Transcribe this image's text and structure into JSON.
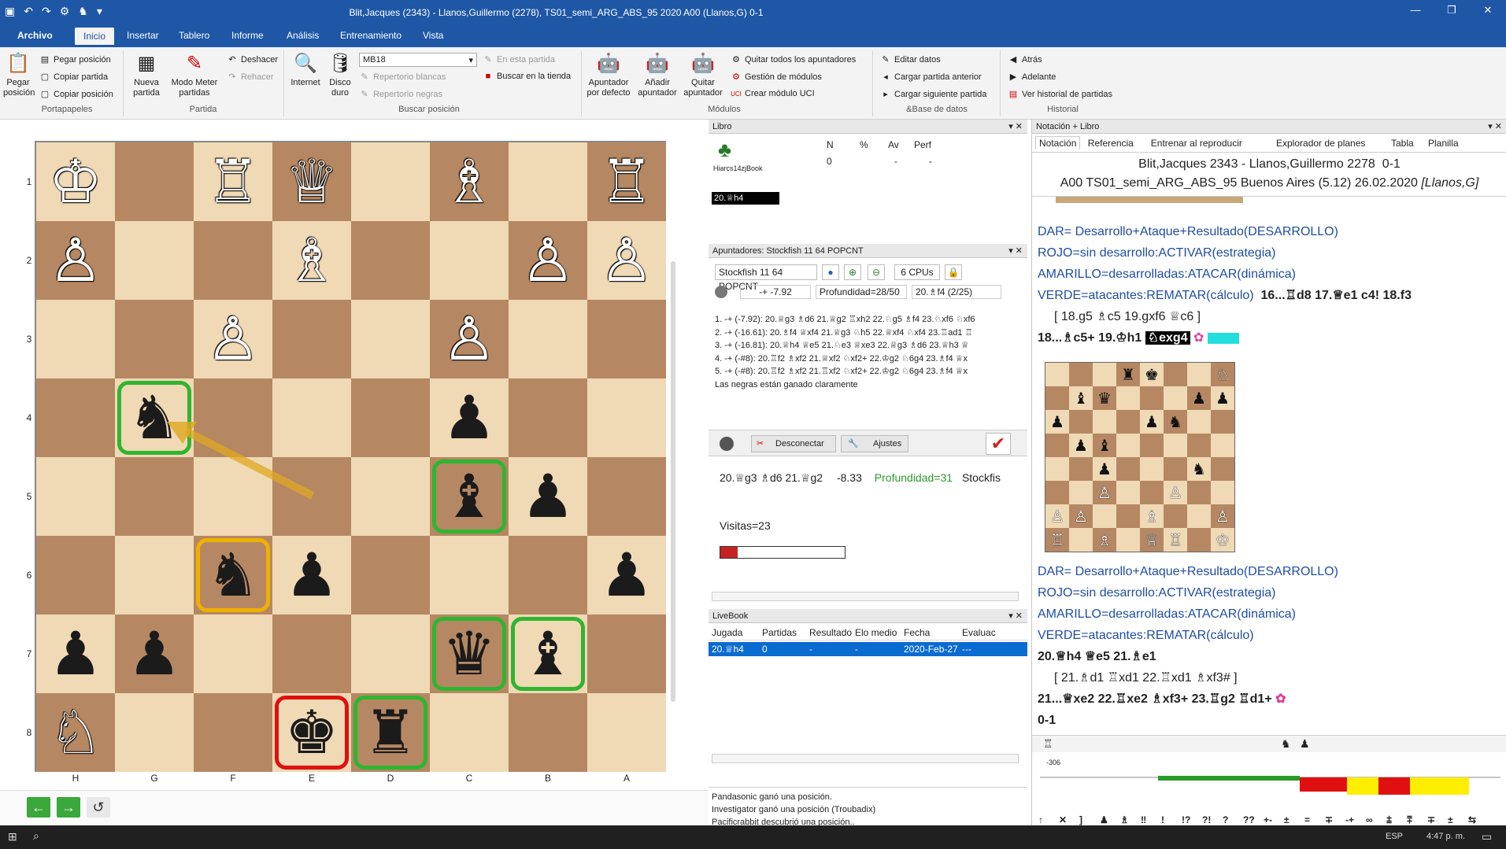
{
  "app": {
    "title": "Blit,Jacques (2343) - Llanos,Guillermo (2278), TS01_semi_ARG_ABS_95  2020  A00  (Llanos,G)  0-1"
  },
  "tabs": [
    {
      "label": "Archivo"
    },
    {
      "label": "Inicio"
    },
    {
      "label": "Insertar"
    },
    {
      "label": "Tablero"
    },
    {
      "label": "Informe"
    },
    {
      "label": "Análisis"
    },
    {
      "label": "Entrenamiento"
    },
    {
      "label": "Vista"
    }
  ],
  "ribbon": {
    "pegar_posicion_big": "Pegar posición",
    "pegar_posicion": "Pegar posición",
    "copiar_partida": "Copiar partida",
    "copiar_posicion": "Copiar posición",
    "portapapeles": "Portapapeles",
    "nueva_partida": "Nueva partida",
    "modo_meter": "Modo Meter partidas",
    "deshacer": "Deshacer",
    "rehacer": "Rehacer",
    "partida": "Partida",
    "internet": "Internet",
    "disco_duro": "Disco duro",
    "db_select": "MB18",
    "en_esta_partida": "En esta partida",
    "repertorio_blancas": "Repertorio blancas",
    "repertorio_negras": "Repertorio negras",
    "buscar_tienda": "Buscar en la tienda",
    "buscar_posicion": "Buscar posición",
    "apuntador_defecto": "Apuntador por defecto",
    "anadir_apuntador": "Añadir apuntador",
    "quitar_apuntador": "Quitar apuntador",
    "quitar_todos": "Quitar todos los apuntadores",
    "gestion_modulos": "Gestión de módulos",
    "crear_uci": "Crear módulo UCI",
    "modulos": "Módulos",
    "editar_datos": "Editar datos",
    "cargar_anterior": "Cargar partida anterior",
    "cargar_siguiente": "Cargar siguiente partida",
    "base_datos": "&Base de datos",
    "atras": "Atrás",
    "adelante": "Adelante",
    "ver_historial": "Ver historial de partidas",
    "historial": "Historial"
  },
  "board": {
    "ranks": [
      "1",
      "2",
      "3",
      "4",
      "5",
      "6",
      "7",
      "8"
    ],
    "files": [
      "H",
      "G",
      "F",
      "E",
      "D",
      "C",
      "B",
      "A"
    ],
    "pieces": [
      {
        "sq": "a",
        "r": 0,
        "f": 0,
        "g": "♔",
        "c": "w"
      },
      {
        "r": 0,
        "f": 2,
        "g": "♖",
        "c": "w"
      },
      {
        "r": 0,
        "f": 3,
        "g": "♕",
        "c": "w"
      },
      {
        "r": 0,
        "f": 5,
        "g": "♗",
        "c": "w"
      },
      {
        "r": 0,
        "f": 7,
        "g": "♖",
        "c": "w"
      },
      {
        "r": 1,
        "f": 0,
        "g": "♙",
        "c": "w"
      },
      {
        "r": 1,
        "f": 3,
        "g": "♗",
        "c": "w"
      },
      {
        "r": 1,
        "f": 6,
        "g": "♙",
        "c": "w"
      },
      {
        "r": 1,
        "f": 7,
        "g": "♙",
        "c": "w"
      },
      {
        "r": 2,
        "f": 2,
        "g": "♙",
        "c": "w"
      },
      {
        "r": 2,
        "f": 5,
        "g": "♙",
        "c": "w"
      },
      {
        "r": 3,
        "f": 1,
        "g": "♞",
        "c": "b"
      },
      {
        "r": 3,
        "f": 5,
        "g": "♟",
        "c": "b"
      },
      {
        "r": 4,
        "f": 5,
        "g": "♝",
        "c": "b"
      },
      {
        "r": 4,
        "f": 6,
        "g": "♟",
        "c": "b"
      },
      {
        "r": 5,
        "f": 2,
        "g": "♞",
        "c": "b"
      },
      {
        "r": 5,
        "f": 3,
        "g": "♟",
        "c": "b"
      },
      {
        "r": 5,
        "f": 7,
        "g": "♟",
        "c": "b"
      },
      {
        "r": 6,
        "f": 0,
        "g": "♟",
        "c": "b"
      },
      {
        "r": 6,
        "f": 1,
        "g": "♟",
        "c": "b"
      },
      {
        "r": 6,
        "f": 5,
        "g": "♛",
        "c": "b"
      },
      {
        "r": 6,
        "f": 6,
        "g": "♝",
        "c": "b"
      },
      {
        "r": 7,
        "f": 0,
        "g": "♘",
        "c": "w"
      },
      {
        "r": 7,
        "f": 3,
        "g": "♚",
        "c": "b"
      },
      {
        "r": 7,
        "f": 4,
        "g": "♜",
        "c": "b"
      }
    ],
    "highlights": [
      {
        "r": 3,
        "f": 1,
        "c": "#2fb52f"
      },
      {
        "r": 4,
        "f": 5,
        "c": "#2fb52f"
      },
      {
        "r": 5,
        "f": 2,
        "c": "#f0b000"
      },
      {
        "r": 6,
        "f": 5,
        "c": "#2fb52f"
      },
      {
        "r": 6,
        "f": 6,
        "c": "#2fb52f"
      },
      {
        "r": 7,
        "f": 3,
        "c": "#e01010"
      },
      {
        "r": 7,
        "f": 4,
        "c": "#2fb52f"
      }
    ]
  },
  "libro": {
    "title": "Libro",
    "h_n": "N",
    "h_pct": "%",
    "h_av": "Av",
    "h_perf": "Perf",
    "book": "Hiarcs14zjBook",
    "n": "0",
    "pct": "-",
    "av": "-",
    "perf": "-",
    "move": "20.♕h4"
  },
  "apuntadores": {
    "title": "Apuntadores: Stockfish 11 64 POPCNT",
    "engine": "Stockfish 11 64 POPCNT",
    "cpus": "6 CPUs",
    "eval": "-+ -7.92",
    "depth": "Profundidad=28/50",
    "curmove": "20.♗f4 (2/25)",
    "lines": [
      "1. -+ (-7.92): 20.♕g3 ♗d6 21.♕g2 ♖xh2 22.♘g5 ♗f4 23.♘xf6 ♘xf6",
      "2. -+ (-16.61): 20.♗f4 ♕xf4 21.♕g3 ♘h5 22.♕xf4 ♘xf4 23.♖ad1 ♖",
      "3. -+ (-16.81): 20.♕h4 ♕e5 21.♘e3 ♕xe3 22.♕g3 ♗d6 23.♕h3 ♕",
      "4. -+ (-#8): 20.♖f2 ♗xf2 21.♕xf2 ♘xf2+ 22.♔g2 ♘6g4 23.♗f4 ♕x",
      "5. -+ (-#8): 20.♖f2 ♗xf2 21.♖xf2 ♘xf2+ 22.♔g2 ♘6g4 23.♗f4 ♕x"
    ],
    "verdict": "Las negras están ganado claramente"
  },
  "kibitzer": {
    "desconectar": "Desconectar",
    "ajustes": "Ajustes",
    "line": "20.♕g3 ♗d6 21.♕g2",
    "score": "-8.33",
    "depth": "Profundidad=31",
    "engine": "Stockfis",
    "visitas": "Visitas=23",
    "progress": 0.14
  },
  "livebook": {
    "title": "LiveBook",
    "headers": [
      "Jugada",
      "Partidas",
      "Resultado",
      "Elo medio",
      "Fecha",
      "Evaluac"
    ],
    "row": [
      "20.♕h4",
      "0",
      "-",
      "-",
      "2020-Feb-27",
      "---"
    ]
  },
  "log": [
    "Pandasonic ganó una posición.",
    "Investigator ganó una posición (Troubadix)",
    "Pacificrabbit descubrió una posición.."
  ],
  "notacion": {
    "title": "Notación + Libro",
    "tabs": [
      "Notación",
      "Referencia",
      "Entrenar al reproducir",
      "Explorador de planes",
      "Tabla",
      "Planilla"
    ],
    "players": "Blit,Jacques",
    "elo1": "2343",
    "sep": "-",
    "black": "Llanos,Guillermo",
    "elo2": "2278",
    "result": "0-1",
    "info": "A00 TS01_semi_ARG_ABS_95  Buenos Aires (5.12) 26.02.2020",
    "annot": "[Llanos,G]",
    "l1": "DAR= Desarrollo+Ataque+Resultado(DESARROLLO)",
    "l2": "ROJO=sin desarrollo:ACTIVAR(estrategia)",
    "l3": "AMARILLO=desarrolladas:ATACAR(dinámica)",
    "l4a": "VERDE=atacantes:REMATAR(cálculo)",
    "l4b": "16...♖d8  17.♕e1  c4!  18.f3",
    "l5": "[ 18.g5  ♗c5  19.gxf6  ♕c6 ]",
    "l6": "18...♗c5+  19.♔h1",
    "cur": "♘exg4",
    "m1": "DAR= Desarrollo+Ataque+Resultado(DESARROLLO)",
    "m2": "ROJO=sin desarrollo:ACTIVAR(estrategia)",
    "m3": "AMARILLO=desarrolladas:ATACAR(dinámica)",
    "m4": "VERDE=atacantes:REMATAR(cálculo)",
    "m5": "20.♕h4  ♕e5  21.♗e1",
    "m6": "[ 21.♗d1  ♖xd1  22.♖xd1  ♗xf3# ]",
    "m7": "21...♕xe2  22.♖xe2  ♗xf3+  23.♖g2  ♖d1+",
    "m8": "0-1",
    "graph_label": "-306"
  },
  "bottom_toolbar": [
    "↑",
    "✕",
    "]",
    "♟",
    "♗",
    "‼",
    "!",
    "!?",
    "?!",
    "?",
    "??",
    "+-",
    "±",
    "=",
    "∓",
    "-+",
    "∞",
    "⩲",
    "⩱",
    "∓",
    "±",
    "⇆"
  ],
  "taskbar": {
    "lang": "ESP",
    "time": "4:47 p. m."
  }
}
